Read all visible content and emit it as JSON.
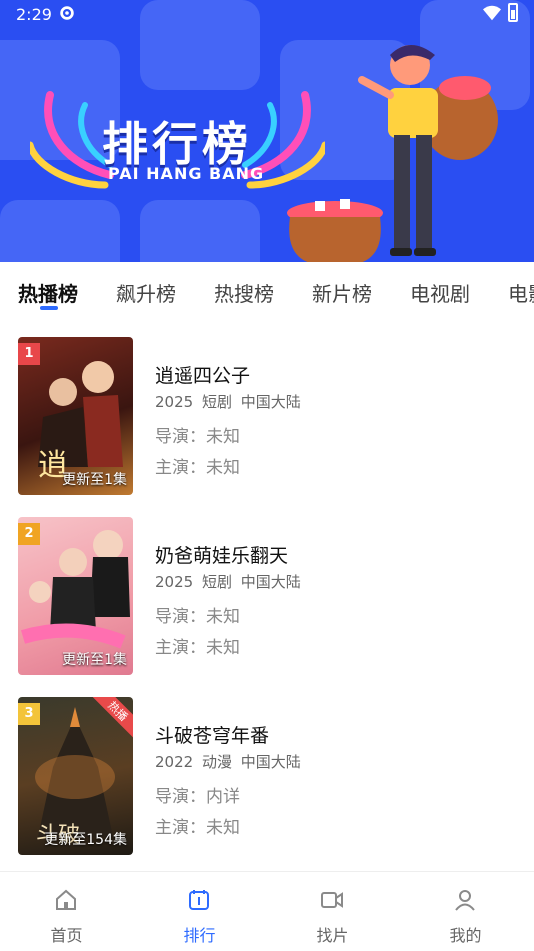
{
  "status_bar": {
    "time": "2:29"
  },
  "banner": {
    "title": "排行榜",
    "subtitle": "PAI HANG BANG"
  },
  "tabs": [
    {
      "label": "热播榜"
    },
    {
      "label": "飙升榜"
    },
    {
      "label": "热搜榜"
    },
    {
      "label": "新片榜"
    },
    {
      "label": "电视剧"
    },
    {
      "label": "电影"
    }
  ],
  "items": [
    {
      "rank": "1",
      "title": "逍遥四公子",
      "year": "2025",
      "genre": "短剧",
      "region": "中国大陆",
      "director": "导演：未知",
      "cast": "主演：未知",
      "update": "更新至1集",
      "rank_color": "#e8474a"
    },
    {
      "rank": "2",
      "title": "奶爸萌娃乐翻天",
      "year": "2025",
      "genre": "短剧",
      "region": "中国大陆",
      "director": "导演：未知",
      "cast": "主演：未知",
      "update": "更新至1集",
      "rank_color": "#f0a423"
    },
    {
      "rank": "3",
      "title": "斗破苍穹年番",
      "year": "2022",
      "genre": "动漫",
      "region": "中国大陆",
      "director": "导演：内详",
      "cast": "主演：未知",
      "update": "更新至154集",
      "rank_color": "#f3c43a",
      "tag": "热播"
    }
  ],
  "bottom_nav": [
    {
      "label": "首页",
      "icon": "home-icon"
    },
    {
      "label": "排行",
      "icon": "rank-icon"
    },
    {
      "label": "找片",
      "icon": "video-icon"
    },
    {
      "label": "我的",
      "icon": "user-icon"
    }
  ],
  "colors": {
    "accent": "#2e6bff",
    "banner": "#2a4ef2"
  }
}
